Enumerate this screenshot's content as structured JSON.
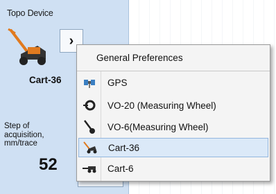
{
  "panel": {
    "title": "Topo Device",
    "device_name": "Cart-36",
    "step_label": "Step of acquisition, mm/trace",
    "step_value": "52",
    "open_button_glyph": "›"
  },
  "menu": {
    "header": "General Preferences",
    "items": [
      {
        "label": "GPS",
        "icon": "gps-icon"
      },
      {
        "label": "VO-20 (Measuring Wheel)",
        "icon": "measuring-wheel-icon"
      },
      {
        "label": "VO-6(Measuring Wheel)",
        "icon": "measuring-wheel-small-icon"
      },
      {
        "label": "Cart-36",
        "icon": "cart-36-icon",
        "selected": true
      },
      {
        "label": "Cart-6",
        "icon": "cart-6-icon"
      }
    ]
  },
  "colors": {
    "panel_bg": "#cfe0f3",
    "selected_bg": "#dbe9f8",
    "cart_orange": "#e07a1f"
  }
}
